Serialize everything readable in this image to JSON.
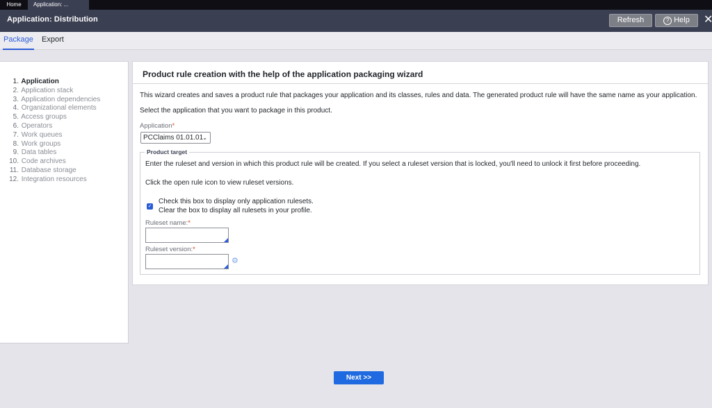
{
  "top_tabs": [
    {
      "label": "Home"
    },
    {
      "label": "Application: ..."
    }
  ],
  "header": {
    "title": "Application: Distribution",
    "refresh_label": "Refresh",
    "help_label": "Help",
    "help_icon_glyph": "?",
    "close_glyph": "✕"
  },
  "subtabs": [
    {
      "label": "Package",
      "active": true
    },
    {
      "label": "Export",
      "active": false
    }
  ],
  "steps": [
    {
      "num": "1.",
      "label": "Application",
      "current": true
    },
    {
      "num": "2.",
      "label": "Application stack"
    },
    {
      "num": "3.",
      "label": "Application dependencies"
    },
    {
      "num": "4.",
      "label": "Organizational elements"
    },
    {
      "num": "5.",
      "label": "Access groups"
    },
    {
      "num": "6.",
      "label": "Operators"
    },
    {
      "num": "7.",
      "label": "Work queues"
    },
    {
      "num": "8.",
      "label": "Work groups"
    },
    {
      "num": "9.",
      "label": "Data tables"
    },
    {
      "num": "10.",
      "label": "Code archives"
    },
    {
      "num": "11.",
      "label": "Database storage"
    },
    {
      "num": "12.",
      "label": "Integration resources"
    }
  ],
  "panel": {
    "title": "Product rule creation with the help of the application packaging wizard",
    "intro": "This wizard creates and saves a product rule that packages your application and its classes, rules and data. The generated product rule will have the same name as your application.",
    "select_prompt": "Select the application that you want to package in this product.",
    "application_label": "Application",
    "required_mark": "*",
    "application_value": "PCClaims 01.01.01",
    "chevron_glyph": "⌄"
  },
  "product_target": {
    "legend": "Product target",
    "instructions": "Enter the ruleset and version in which this product rule will be created. If you select a ruleset version that is locked, you'll need to unlock it first before proceeding.",
    "open_rule_hint": "Click the open rule icon to view ruleset versions.",
    "checkbox_checked": true,
    "checkbox_line1": "Check this box to display only application rulesets.",
    "checkbox_line2": "Clear the box to display all rulesets in your profile.",
    "ruleset_name_label": "Ruleset name:",
    "ruleset_name_value": "",
    "ruleset_version_label": "Ruleset version:",
    "ruleset_version_value": "",
    "required_mark": "*"
  },
  "footer": {
    "next_label": "Next >>"
  },
  "colors": {
    "accent": "#2a5bd7",
    "header_bg": "#3b3f52",
    "primary_button": "#1f6ae0",
    "required": "#d14a1d"
  },
  "icons": [
    "help-icon",
    "close-icon",
    "chevron-down-icon",
    "checkbox-check-icon",
    "open-rule-gear-icon"
  ]
}
